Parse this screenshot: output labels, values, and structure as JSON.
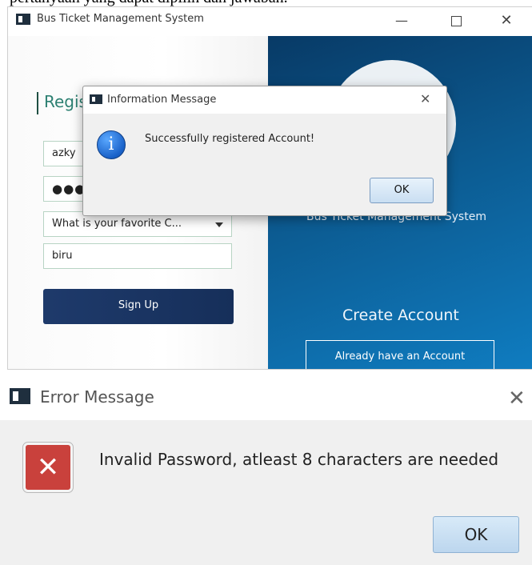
{
  "doc_text": "pertanyaan yang dapat dipilih dan jawaban.",
  "app": {
    "title": "Bus Ticket Management System",
    "window_controls": {
      "minimize": "—",
      "maximize": "",
      "close": "✕"
    },
    "form": {
      "heading": "Regis",
      "username_value": "azky",
      "password_value": "●●●●",
      "question_value": "What is your favorite C...",
      "answer_value": "biru",
      "signup_label": "Sign Up"
    },
    "side": {
      "brand": "Bus Ticket Management System",
      "create_heading": "Create Account",
      "login_label": "Already have an Account"
    }
  },
  "info_dialog": {
    "title": "Information Message",
    "close": "✕",
    "icon_glyph": "i",
    "message": "Successfully registered Account!",
    "ok_label": "OK"
  },
  "error_dialog": {
    "title": "Error Message",
    "close": "✕",
    "icon_glyph": "✕",
    "message": "Invalid Password, atleast 8 characters are needed",
    "ok_label": "OK"
  },
  "colors": {
    "accent_blue": "#0c5a90",
    "signup_blue": "#1e3a6b",
    "heading_green": "#2d8072",
    "error_red": "#c9413c"
  }
}
